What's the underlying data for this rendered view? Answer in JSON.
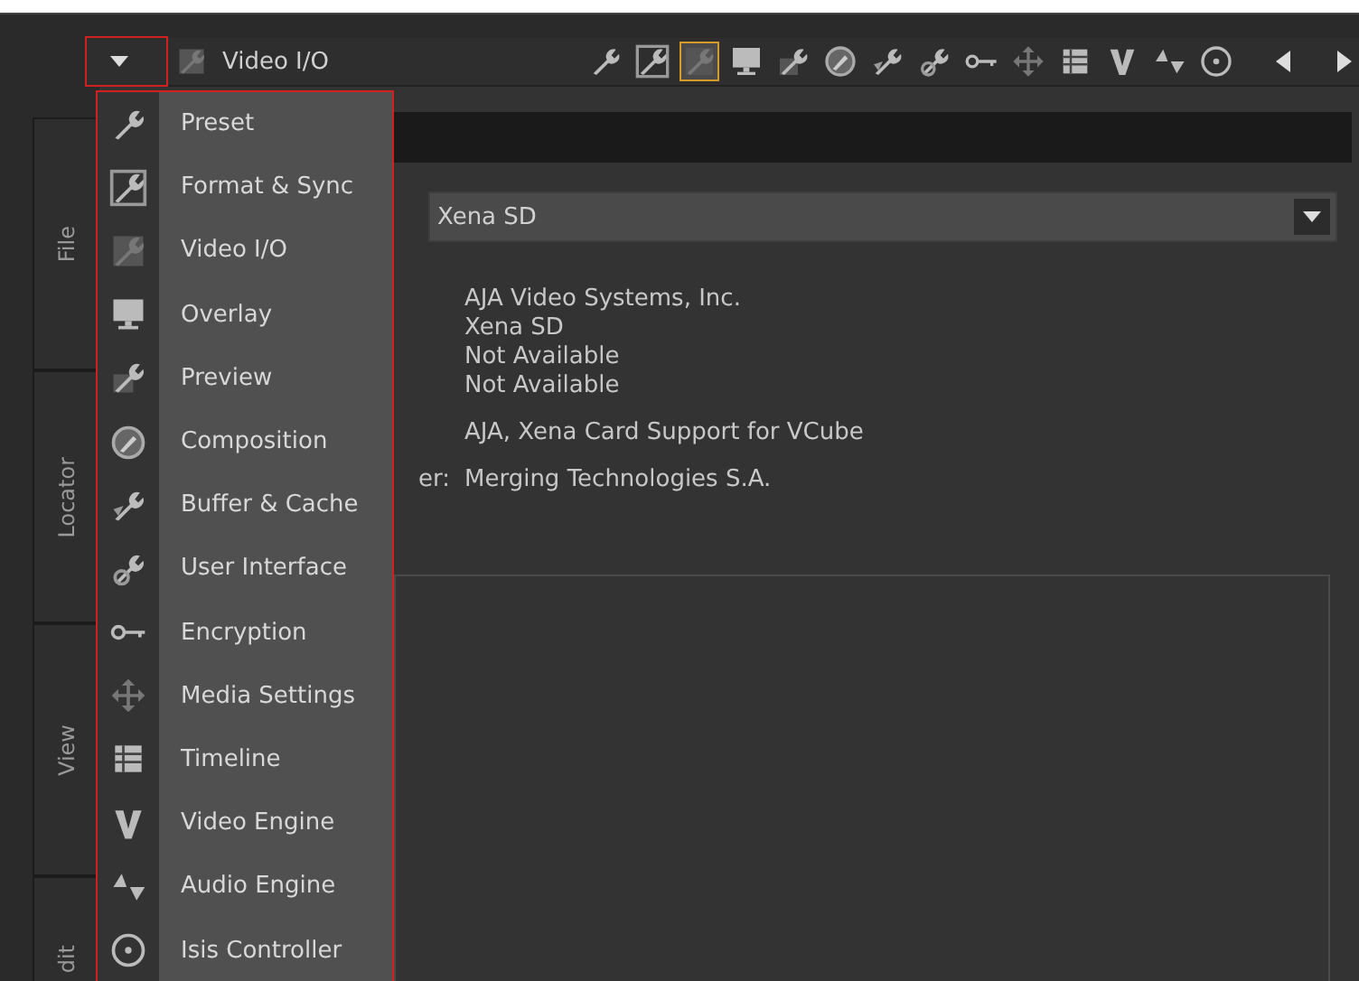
{
  "header": {
    "title": "Video I/O",
    "toolbar": [
      {
        "selected": false
      },
      {
        "selected": false
      },
      {
        "selected": true
      },
      {
        "selected": false
      },
      {
        "selected": false
      },
      {
        "selected": false
      },
      {
        "selected": false
      },
      {
        "selected": false
      },
      {
        "selected": false
      },
      {
        "selected": false
      },
      {
        "selected": false
      },
      {
        "selected": false
      },
      {
        "selected": false
      },
      {
        "selected": false
      }
    ]
  },
  "side_tabs": [
    "File",
    "Locator",
    "View",
    "dit"
  ],
  "device_select": {
    "value": "Xena SD"
  },
  "info_rows": [
    {
      "value": "AJA Video Systems, Inc."
    },
    {
      "value": "Xena SD"
    },
    {
      "value": "Not Available"
    },
    {
      "value": "Not Available"
    },
    {
      "value": "AJA, Xena Card Support for VCube"
    },
    {
      "label": "er:",
      "value": "Merging Technologies S.A."
    }
  ],
  "menu": [
    {
      "label": "Preset"
    },
    {
      "label": "Format & Sync"
    },
    {
      "label": "Video I/O"
    },
    {
      "label": "Overlay"
    },
    {
      "label": "Preview"
    },
    {
      "label": "Composition"
    },
    {
      "label": "Buffer & Cache"
    },
    {
      "label": "User Interface"
    },
    {
      "label": "Encryption"
    },
    {
      "label": "Media Settings"
    },
    {
      "label": "Timeline"
    },
    {
      "label": "Video Engine"
    },
    {
      "label": "Audio Engine"
    },
    {
      "label": "Isis Controller"
    }
  ]
}
